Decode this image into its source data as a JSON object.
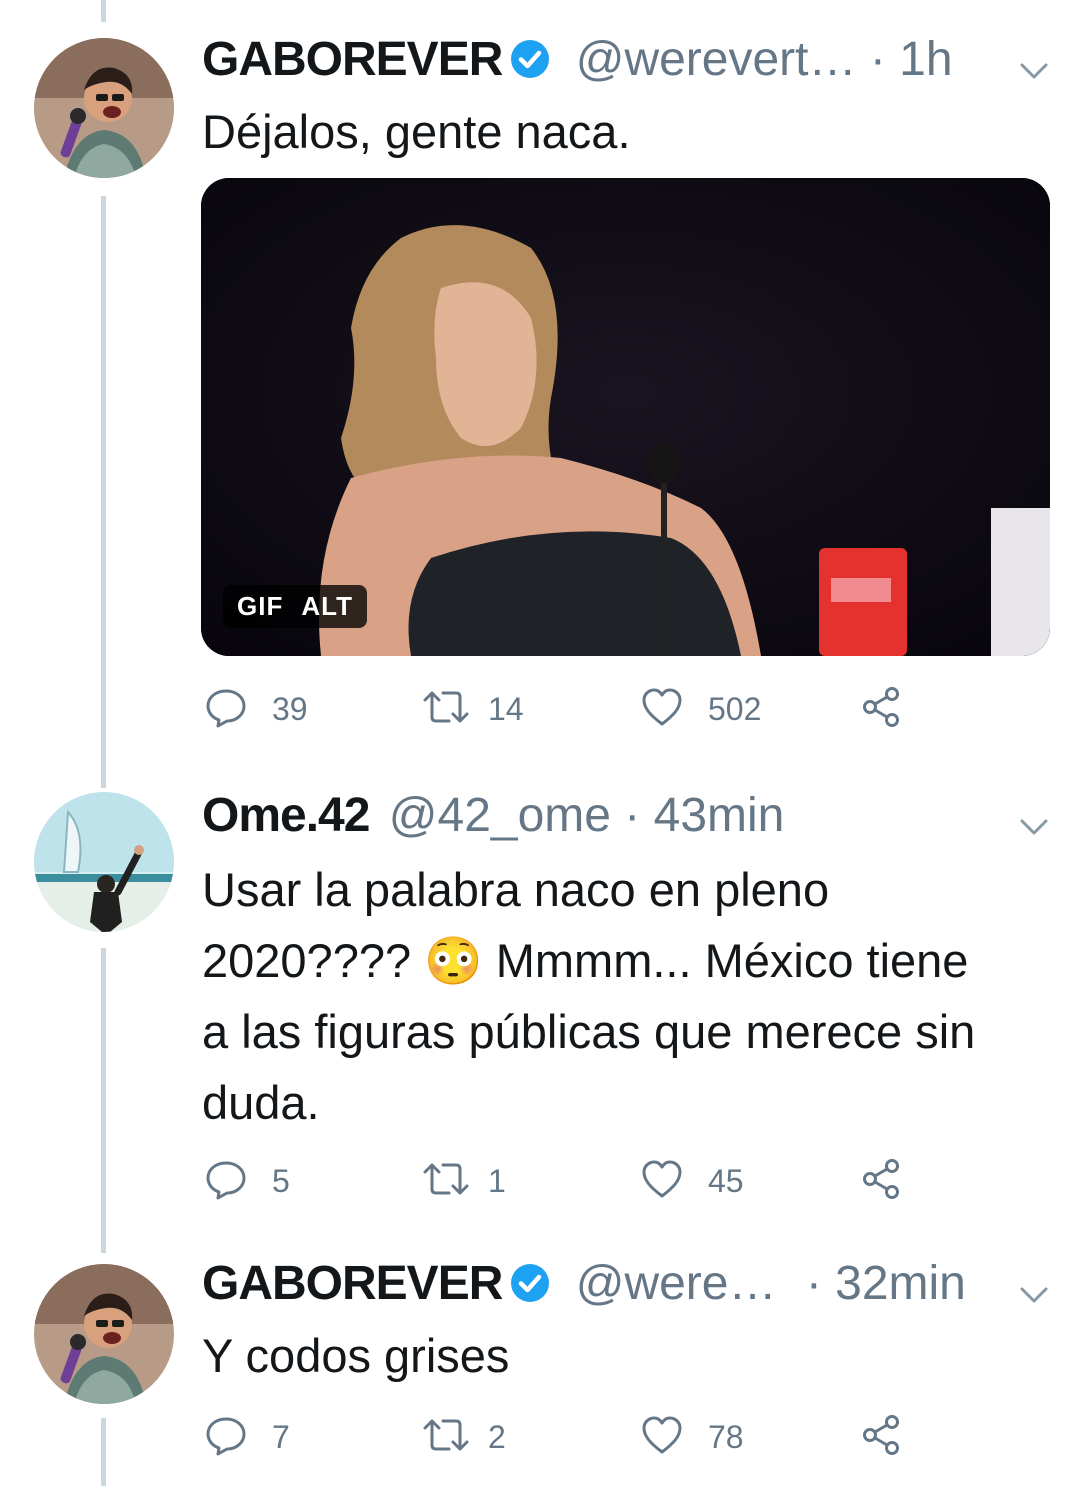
{
  "tweets": [
    {
      "name": "GABOREVER",
      "verified": true,
      "handle": "@werevert…",
      "dot": " · ",
      "time": "1h",
      "text": "Déjalos, gente naca.",
      "media": {
        "badge_gif": "GIF",
        "badge_alt": "ALT"
      },
      "stats": {
        "replies": "39",
        "retweets": "14",
        "likes": "502"
      }
    },
    {
      "name": "Ome.42",
      "verified": false,
      "handle": "@42_ome",
      "dot": " · ",
      "time": "43min",
      "text": "Usar la palabra naco en pleno 2020???? 😳 Mmmm... México tiene a las figuras públicas que merece sin duda.",
      "stats": {
        "replies": "5",
        "retweets": "1",
        "likes": "45"
      }
    },
    {
      "name": "GABOREVER",
      "verified": true,
      "handle": "@were…",
      "dot": " · ",
      "time": "32min",
      "text": "Y codos grises",
      "stats": {
        "replies": "7",
        "retweets": "2",
        "likes": "78"
      }
    }
  ],
  "icons": {
    "reply": "reply-icon",
    "retweet": "retweet-icon",
    "like": "heart-icon",
    "share": "share-icon",
    "caret": "chevron-down-icon",
    "verified": "verified-badge-icon"
  },
  "colors": {
    "verified": "#1da1f2",
    "secondary": "#657786",
    "thread_line": "#ccd6dd"
  }
}
